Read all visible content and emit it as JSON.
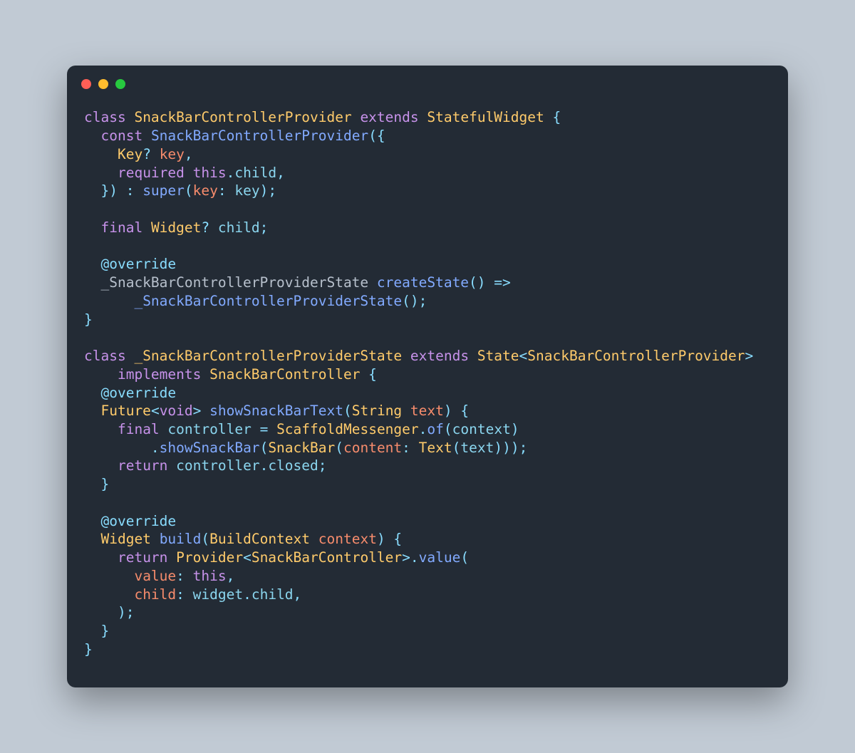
{
  "window": {
    "buttons": [
      "close",
      "minimize",
      "zoom"
    ]
  },
  "code": {
    "lines": [
      [
        {
          "t": "class ",
          "c": "kw"
        },
        {
          "t": "SnackBarControllerProvider",
          "c": "type"
        },
        {
          "t": " extends ",
          "c": "kw"
        },
        {
          "t": "StatefulWidget",
          "c": "type"
        },
        {
          "t": " {",
          "c": "punct"
        }
      ],
      [
        {
          "t": "  ",
          "c": "plain"
        },
        {
          "t": "const ",
          "c": "kw"
        },
        {
          "t": "SnackBarControllerProvider",
          "c": "call"
        },
        {
          "t": "({",
          "c": "punct"
        }
      ],
      [
        {
          "t": "    ",
          "c": "plain"
        },
        {
          "t": "Key",
          "c": "type"
        },
        {
          "t": "?",
          "c": "punct"
        },
        {
          "t": " key",
          "c": "param"
        },
        {
          "t": ",",
          "c": "punct"
        }
      ],
      [
        {
          "t": "    ",
          "c": "plain"
        },
        {
          "t": "required ",
          "c": "kw"
        },
        {
          "t": "this",
          "c": "kw"
        },
        {
          "t": ".",
          "c": "punct"
        },
        {
          "t": "child",
          "c": "prop"
        },
        {
          "t": ",",
          "c": "punct"
        }
      ],
      [
        {
          "t": "  }) : ",
          "c": "punct"
        },
        {
          "t": "super",
          "c": "call"
        },
        {
          "t": "(",
          "c": "punct"
        },
        {
          "t": "key",
          "c": "param"
        },
        {
          "t": ": ",
          "c": "punct"
        },
        {
          "t": "key",
          "c": "prop"
        },
        {
          "t": ");",
          "c": "punct"
        }
      ],
      [
        {
          "t": "",
          "c": "plain"
        }
      ],
      [
        {
          "t": "  ",
          "c": "plain"
        },
        {
          "t": "final ",
          "c": "kw"
        },
        {
          "t": "Widget",
          "c": "type"
        },
        {
          "t": "?",
          "c": "punct"
        },
        {
          "t": " child",
          "c": "prop"
        },
        {
          "t": ";",
          "c": "punct"
        }
      ],
      [
        {
          "t": "",
          "c": "plain"
        }
      ],
      [
        {
          "t": "  ",
          "c": "plain"
        },
        {
          "t": "@override",
          "c": "ann"
        }
      ],
      [
        {
          "t": "  _SnackBarControllerProviderState ",
          "c": "soft"
        },
        {
          "t": "createState",
          "c": "call"
        },
        {
          "t": "() =>",
          "c": "punct"
        }
      ],
      [
        {
          "t": "      ",
          "c": "plain"
        },
        {
          "t": "_SnackBarControllerProviderState",
          "c": "call"
        },
        {
          "t": "();",
          "c": "punct"
        }
      ],
      [
        {
          "t": "}",
          "c": "punct"
        }
      ],
      [
        {
          "t": "",
          "c": "plain"
        }
      ],
      [
        {
          "t": "class ",
          "c": "kw"
        },
        {
          "t": "_SnackBarControllerProviderState",
          "c": "type"
        },
        {
          "t": " extends ",
          "c": "kw"
        },
        {
          "t": "State",
          "c": "type"
        },
        {
          "t": "<",
          "c": "punct"
        },
        {
          "t": "SnackBarControllerProvider",
          "c": "type"
        },
        {
          "t": ">",
          "c": "punct"
        }
      ],
      [
        {
          "t": "    ",
          "c": "plain"
        },
        {
          "t": "implements ",
          "c": "kw"
        },
        {
          "t": "SnackBarController",
          "c": "type"
        },
        {
          "t": " {",
          "c": "punct"
        }
      ],
      [
        {
          "t": "  ",
          "c": "plain"
        },
        {
          "t": "@override",
          "c": "ann"
        }
      ],
      [
        {
          "t": "  ",
          "c": "plain"
        },
        {
          "t": "Future",
          "c": "type"
        },
        {
          "t": "<",
          "c": "punct"
        },
        {
          "t": "void",
          "c": "kw"
        },
        {
          "t": "> ",
          "c": "punct"
        },
        {
          "t": "showSnackBarText",
          "c": "call"
        },
        {
          "t": "(",
          "c": "punct"
        },
        {
          "t": "String",
          "c": "type"
        },
        {
          "t": " text",
          "c": "param"
        },
        {
          "t": ") {",
          "c": "punct"
        }
      ],
      [
        {
          "t": "    ",
          "c": "plain"
        },
        {
          "t": "final ",
          "c": "kw"
        },
        {
          "t": "controller",
          "c": "prop"
        },
        {
          "t": " = ",
          "c": "punct"
        },
        {
          "t": "ScaffoldMessenger",
          "c": "type"
        },
        {
          "t": ".",
          "c": "punct"
        },
        {
          "t": "of",
          "c": "call"
        },
        {
          "t": "(",
          "c": "punct"
        },
        {
          "t": "context",
          "c": "prop"
        },
        {
          "t": ")",
          "c": "punct"
        }
      ],
      [
        {
          "t": "        .",
          "c": "punct"
        },
        {
          "t": "showSnackBar",
          "c": "call"
        },
        {
          "t": "(",
          "c": "punct"
        },
        {
          "t": "SnackBar",
          "c": "type"
        },
        {
          "t": "(",
          "c": "punct"
        },
        {
          "t": "content",
          "c": "param"
        },
        {
          "t": ": ",
          "c": "punct"
        },
        {
          "t": "Text",
          "c": "type"
        },
        {
          "t": "(",
          "c": "punct"
        },
        {
          "t": "text",
          "c": "prop"
        },
        {
          "t": ")));",
          "c": "punct"
        }
      ],
      [
        {
          "t": "    ",
          "c": "plain"
        },
        {
          "t": "return ",
          "c": "kw"
        },
        {
          "t": "controller",
          "c": "prop"
        },
        {
          "t": ".",
          "c": "punct"
        },
        {
          "t": "closed",
          "c": "prop"
        },
        {
          "t": ";",
          "c": "punct"
        }
      ],
      [
        {
          "t": "  }",
          "c": "punct"
        }
      ],
      [
        {
          "t": "",
          "c": "plain"
        }
      ],
      [
        {
          "t": "  ",
          "c": "plain"
        },
        {
          "t": "@override",
          "c": "ann"
        }
      ],
      [
        {
          "t": "  ",
          "c": "plain"
        },
        {
          "t": "Widget",
          "c": "type"
        },
        {
          "t": " ",
          "c": "plain"
        },
        {
          "t": "build",
          "c": "call"
        },
        {
          "t": "(",
          "c": "punct"
        },
        {
          "t": "BuildContext",
          "c": "type"
        },
        {
          "t": " context",
          "c": "param"
        },
        {
          "t": ") {",
          "c": "punct"
        }
      ],
      [
        {
          "t": "    ",
          "c": "plain"
        },
        {
          "t": "return ",
          "c": "kw"
        },
        {
          "t": "Provider",
          "c": "type"
        },
        {
          "t": "<",
          "c": "punct"
        },
        {
          "t": "SnackBarController",
          "c": "type"
        },
        {
          "t": ">.",
          "c": "punct"
        },
        {
          "t": "value",
          "c": "call"
        },
        {
          "t": "(",
          "c": "punct"
        }
      ],
      [
        {
          "t": "      ",
          "c": "plain"
        },
        {
          "t": "value",
          "c": "param"
        },
        {
          "t": ": ",
          "c": "punct"
        },
        {
          "t": "this",
          "c": "kw"
        },
        {
          "t": ",",
          "c": "punct"
        }
      ],
      [
        {
          "t": "      ",
          "c": "plain"
        },
        {
          "t": "child",
          "c": "param"
        },
        {
          "t": ": ",
          "c": "punct"
        },
        {
          "t": "widget",
          "c": "prop"
        },
        {
          "t": ".",
          "c": "punct"
        },
        {
          "t": "child",
          "c": "prop"
        },
        {
          "t": ",",
          "c": "punct"
        }
      ],
      [
        {
          "t": "    );",
          "c": "punct"
        }
      ],
      [
        {
          "t": "  }",
          "c": "punct"
        }
      ],
      [
        {
          "t": "}",
          "c": "punct"
        }
      ]
    ]
  }
}
